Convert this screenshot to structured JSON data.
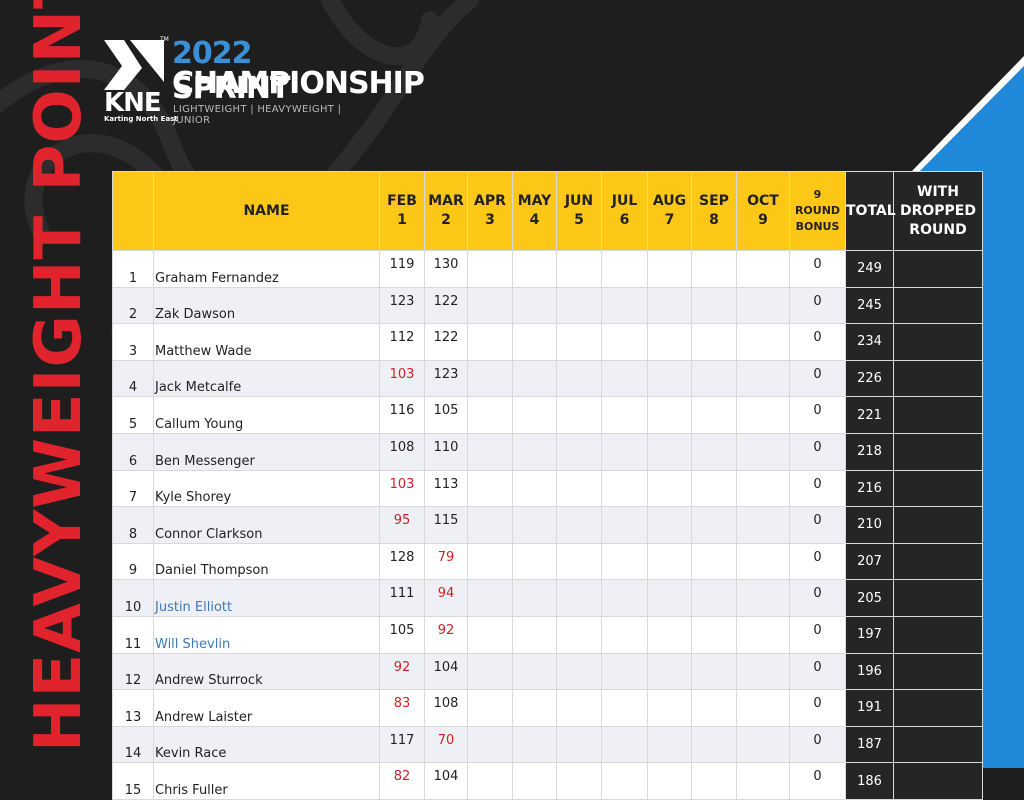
{
  "side_title": "HEAVYWEIGHT POINTS",
  "logo": {
    "mark_text": "KNE",
    "tm": "TM",
    "tagline": "Karting North East",
    "title_year": "2022",
    "title_sprint": "SPRINT",
    "title_line2": "CHAMPIONSHIP",
    "classes": "LIGHTWEIGHT | HEAVYWEIGHT | JUNIOR"
  },
  "colors": {
    "accent_yellow": "#fdc718",
    "accent_red": "#e0232c",
    "accent_blue": "#1f88d9",
    "dark": "#252525"
  },
  "headers": {
    "pos": "",
    "name": "NAME",
    "rounds": [
      {
        "month": "FEB",
        "num": "1"
      },
      {
        "month": "MAR",
        "num": "2"
      },
      {
        "month": "APR",
        "num": "3"
      },
      {
        "month": "MAY",
        "num": "4"
      },
      {
        "month": "JUN",
        "num": "5"
      },
      {
        "month": "JUL",
        "num": "6"
      },
      {
        "month": "AUG",
        "num": "7"
      },
      {
        "month": "SEP",
        "num": "8"
      },
      {
        "month": "OCT",
        "num": "9"
      }
    ],
    "bonus_line1": "9 ROUND",
    "bonus_line2": "BONUS",
    "total": "TOTAL",
    "dropped_line1": "WITH",
    "dropped_line2": "DROPPED",
    "dropped_line3": "ROUND"
  },
  "rows": [
    {
      "pos": "1",
      "name": "Graham Fernandez",
      "feb": "119",
      "mar": "130",
      "feb_dropped": false,
      "mar_dropped": false,
      "name_blue": false,
      "bonus": "0",
      "total": "249"
    },
    {
      "pos": "2",
      "name": "Zak Dawson",
      "feb": "123",
      "mar": "122",
      "feb_dropped": false,
      "mar_dropped": false,
      "name_blue": false,
      "bonus": "0",
      "total": "245"
    },
    {
      "pos": "3",
      "name": "Matthew Wade",
      "feb": "112",
      "mar": "122",
      "feb_dropped": false,
      "mar_dropped": false,
      "name_blue": false,
      "bonus": "0",
      "total": "234"
    },
    {
      "pos": "4",
      "name": "Jack Metcalfe",
      "feb": "103",
      "mar": "123",
      "feb_dropped": true,
      "mar_dropped": false,
      "name_blue": false,
      "bonus": "0",
      "total": "226"
    },
    {
      "pos": "5",
      "name": "Callum Young",
      "feb": "116",
      "mar": "105",
      "feb_dropped": false,
      "mar_dropped": false,
      "name_blue": false,
      "bonus": "0",
      "total": "221"
    },
    {
      "pos": "6",
      "name": "Ben Messenger",
      "feb": "108",
      "mar": "110",
      "feb_dropped": false,
      "mar_dropped": false,
      "name_blue": false,
      "bonus": "0",
      "total": "218"
    },
    {
      "pos": "7",
      "name": "Kyle Shorey",
      "feb": "103",
      "mar": "113",
      "feb_dropped": true,
      "mar_dropped": false,
      "name_blue": false,
      "bonus": "0",
      "total": "216"
    },
    {
      "pos": "8",
      "name": "Connor Clarkson",
      "feb": "95",
      "mar": "115",
      "feb_dropped": true,
      "mar_dropped": false,
      "name_blue": false,
      "bonus": "0",
      "total": "210"
    },
    {
      "pos": "9",
      "name": "Daniel Thompson",
      "feb": "128",
      "mar": "79",
      "feb_dropped": false,
      "mar_dropped": true,
      "name_blue": false,
      "bonus": "0",
      "total": "207"
    },
    {
      "pos": "10",
      "name": "Justin Elliott",
      "feb": "111",
      "mar": "94",
      "feb_dropped": false,
      "mar_dropped": true,
      "name_blue": true,
      "bonus": "0",
      "total": "205"
    },
    {
      "pos": "11",
      "name": "Will Shevlin",
      "feb": "105",
      "mar": "92",
      "feb_dropped": false,
      "mar_dropped": true,
      "name_blue": true,
      "bonus": "0",
      "total": "197"
    },
    {
      "pos": "12",
      "name": "Andrew Sturrock",
      "feb": "92",
      "mar": "104",
      "feb_dropped": true,
      "mar_dropped": false,
      "name_blue": false,
      "bonus": "0",
      "total": "196"
    },
    {
      "pos": "13",
      "name": "Andrew Laister",
      "feb": "83",
      "mar": "108",
      "feb_dropped": true,
      "mar_dropped": false,
      "name_blue": false,
      "bonus": "0",
      "total": "191"
    },
    {
      "pos": "14",
      "name": "Kevin Race",
      "feb": "117",
      "mar": "70",
      "feb_dropped": false,
      "mar_dropped": true,
      "name_blue": false,
      "bonus": "0",
      "total": "187"
    },
    {
      "pos": "15",
      "name": "Chris Fuller",
      "feb": "82",
      "mar": "104",
      "feb_dropped": true,
      "mar_dropped": false,
      "name_blue": false,
      "bonus": "0",
      "total": "186"
    }
  ]
}
